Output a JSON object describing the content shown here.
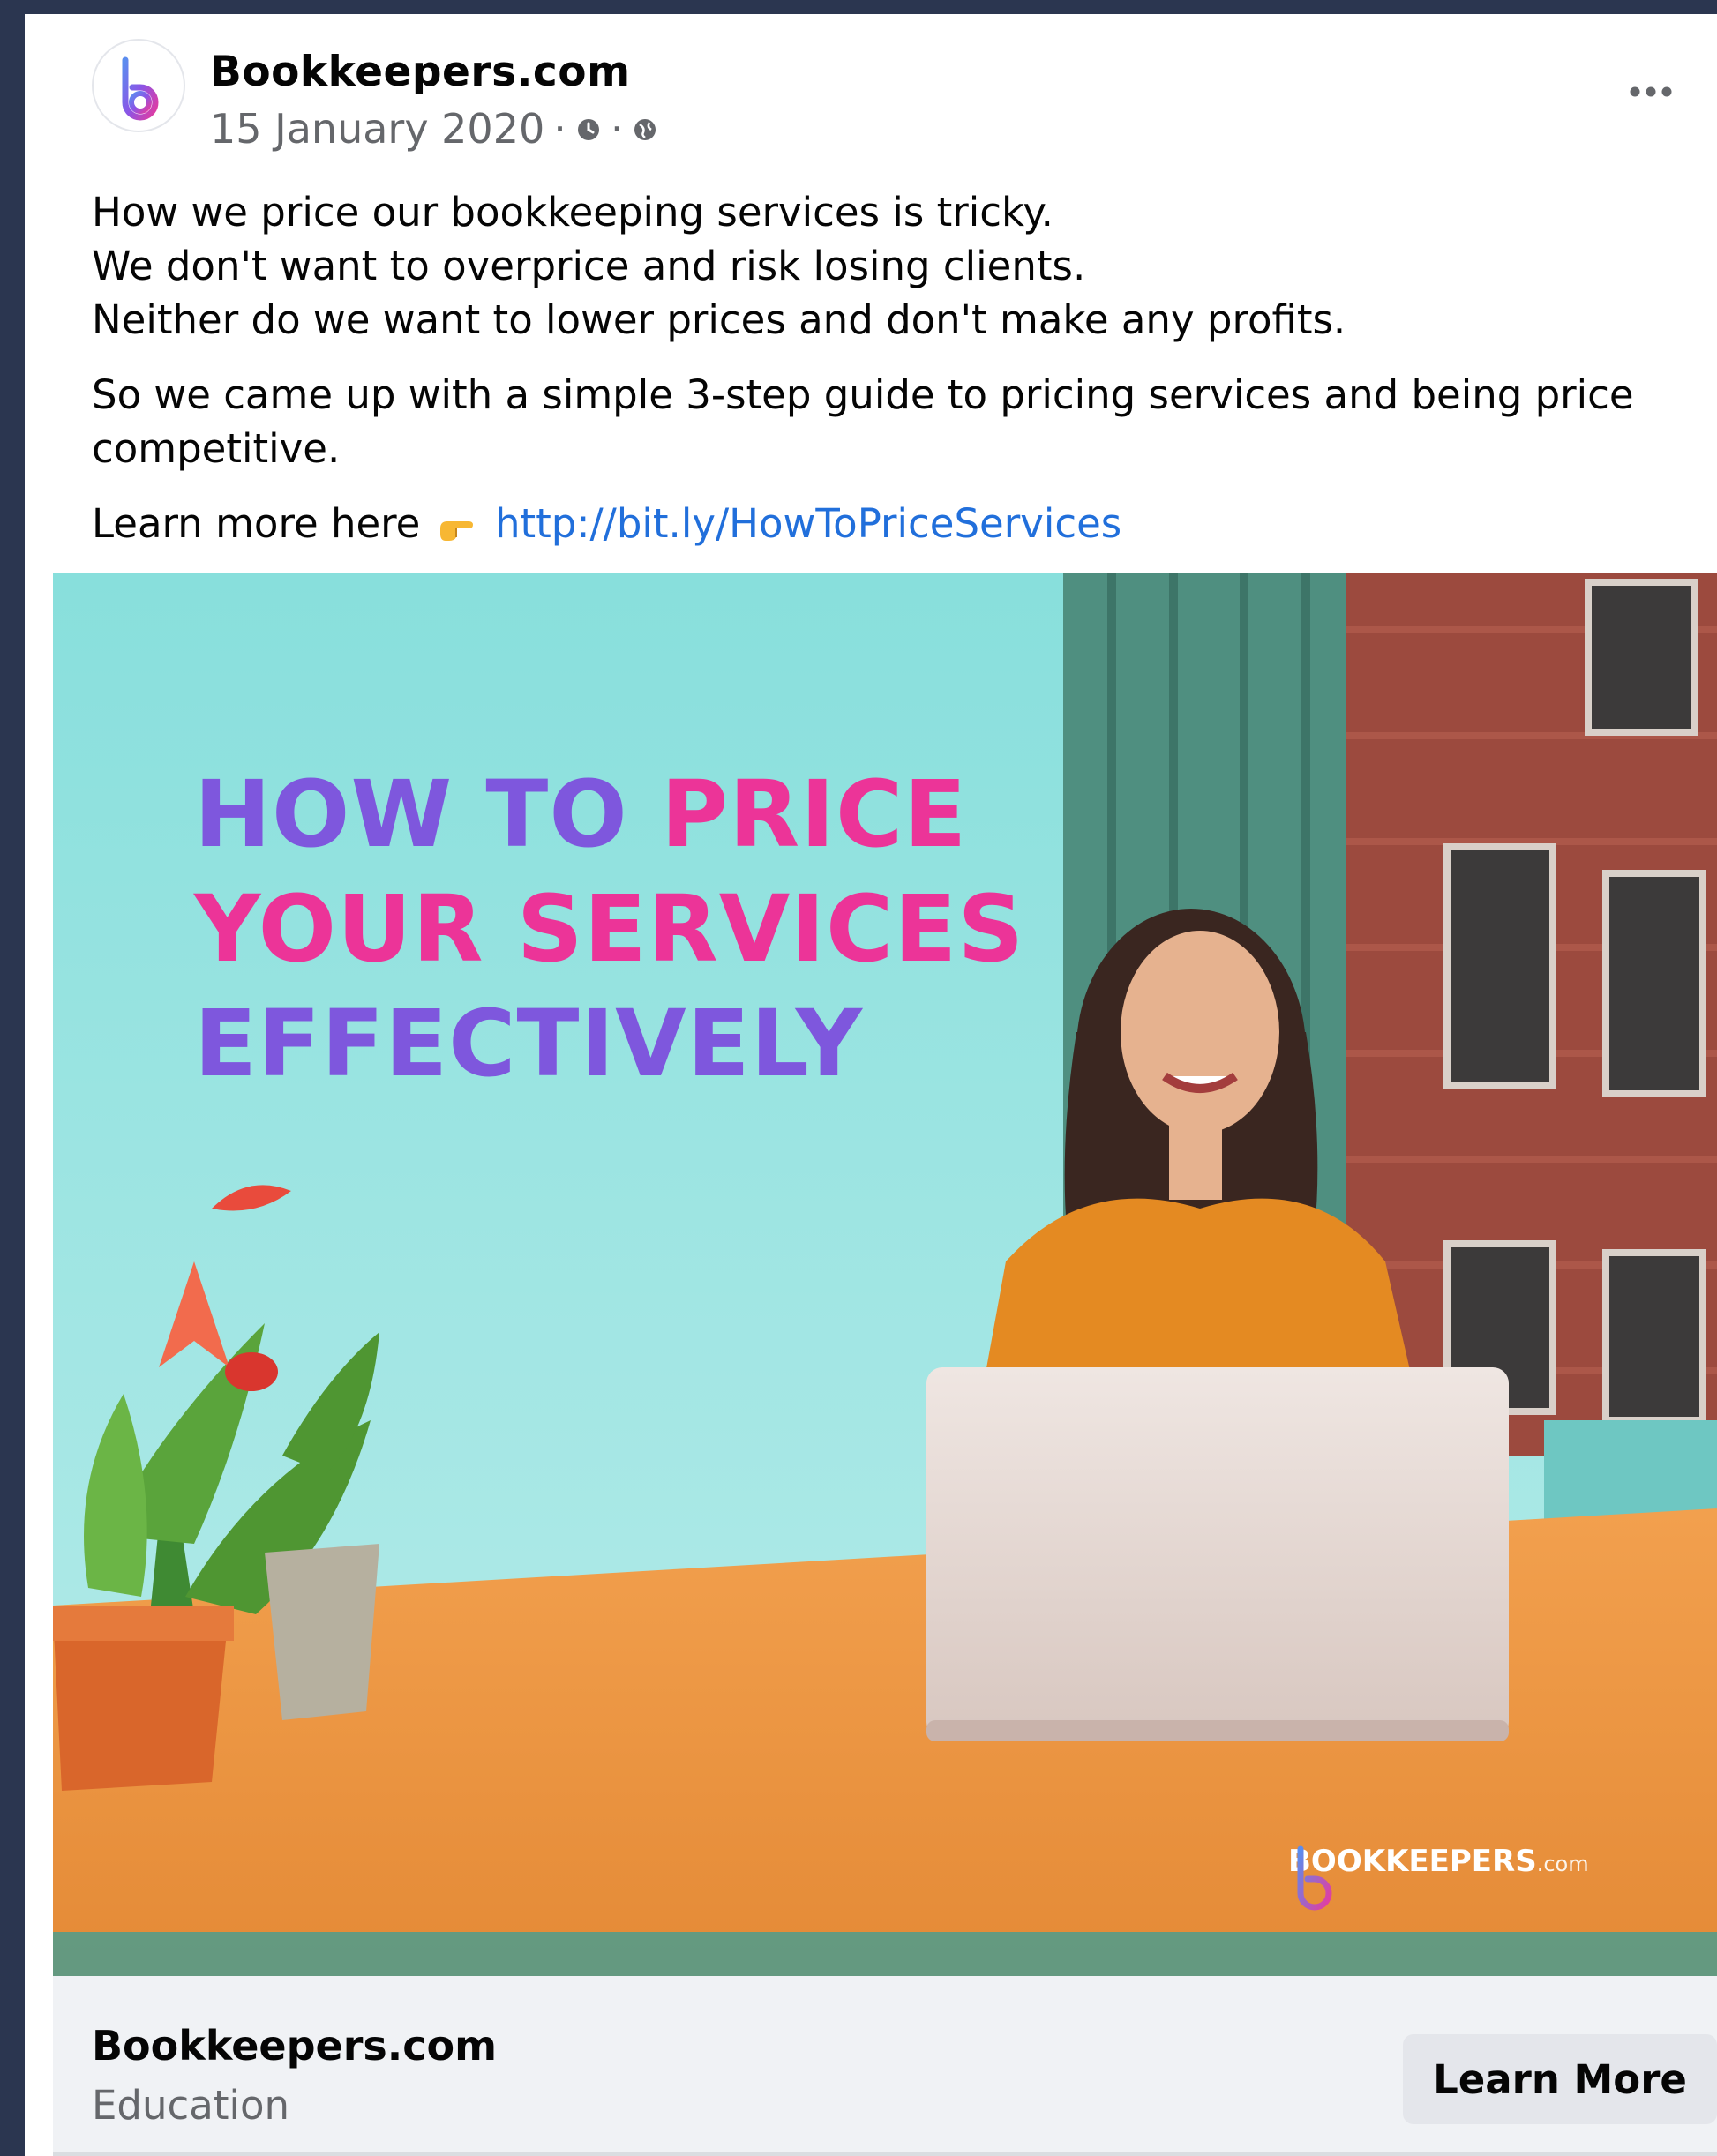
{
  "post": {
    "page_name": "Bookkeepers.com",
    "date": "15 January 2020",
    "separator": "·",
    "meta_icons": [
      "clock-icon",
      "globe-icon"
    ],
    "more_label": "•••",
    "text_lines": [
      "How we price our bookkeeping services is tricky.",
      "We don't want to overprice and risk losing clients.",
      "Neither do we want to lower prices and don't make any profits."
    ],
    "paragraph2": "So we came up with a simple 3-step guide to pricing services and being price competitive.",
    "learn_more_prefix": "Learn more here",
    "link": "http://bit.ly/HowToPriceServices"
  },
  "media": {
    "headline": {
      "line1_a": "HOW TO ",
      "line1_b": "PRICE",
      "line2": "YOUR SERVICES",
      "line3": "EFFECTIVELY"
    },
    "watermark": {
      "brand": "BOOKKEEPERS",
      "suffix": ".com"
    }
  },
  "link_preview": {
    "title": "Bookkeepers.com",
    "category": "Education",
    "cta_label": "Learn More"
  },
  "colors": {
    "brand_purple": "#7e57dd",
    "brand_pink": "#ec3498",
    "link_blue": "#216fdb",
    "frame_dark": "#2b3650"
  }
}
